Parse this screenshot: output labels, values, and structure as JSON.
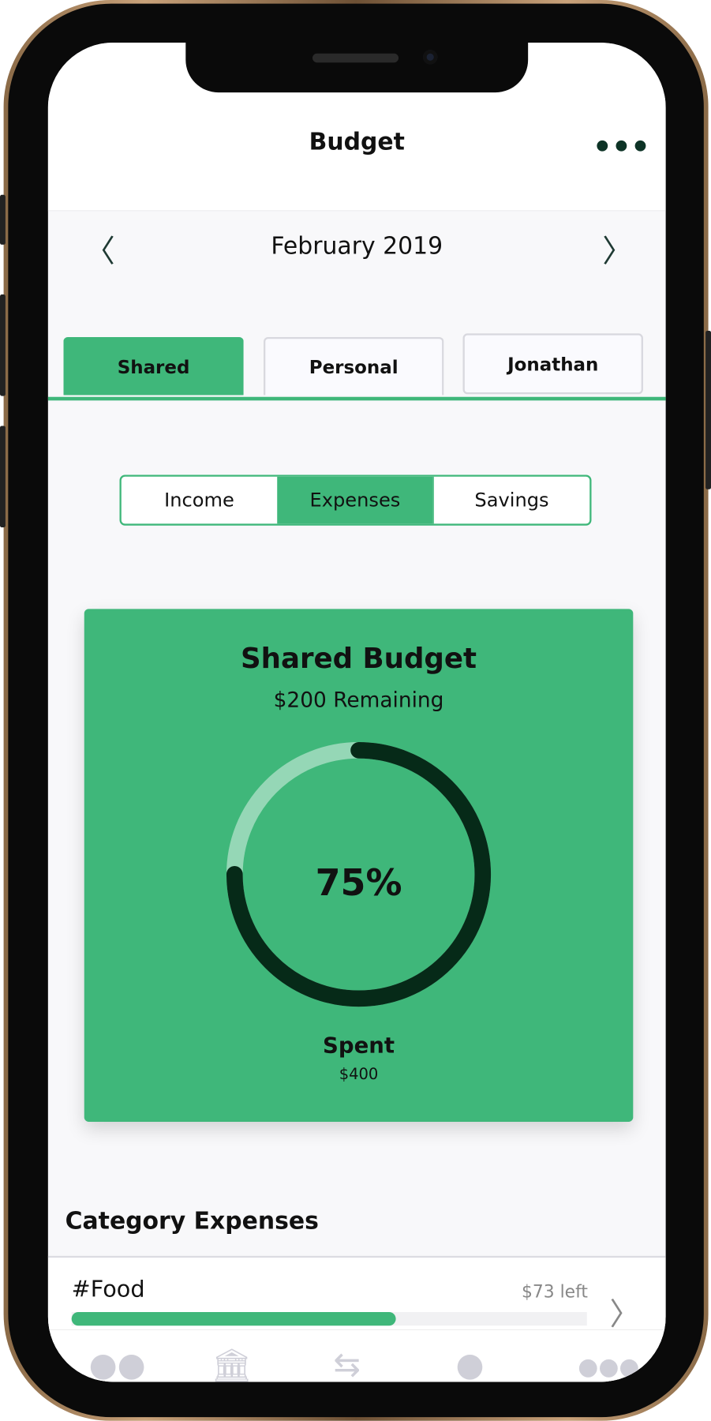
{
  "header": {
    "title": "Budget",
    "menu_icon": "more-dots-icon"
  },
  "month_nav": {
    "label": "February 2019",
    "prev_icon": "chevron-left-icon",
    "next_icon": "chevron-right-icon"
  },
  "tabs": [
    {
      "label": "Shared",
      "active": true
    },
    {
      "label": "Personal",
      "active": false
    },
    {
      "label": "Jonathan",
      "active": false
    }
  ],
  "segments": [
    {
      "label": "Income",
      "active": false
    },
    {
      "label": "Expenses",
      "active": true
    },
    {
      "label": "Savings",
      "active": false
    }
  ],
  "budget_card": {
    "title": "Shared Budget",
    "remaining": "$200 Remaining",
    "percent_label": "75%",
    "percent_value": 75,
    "spent_label": "Spent",
    "spent_value": "$400"
  },
  "category_section": {
    "title": "Category Expenses",
    "items": [
      {
        "name": "#Food",
        "left": "$73 left",
        "progress_percent": 63
      }
    ]
  },
  "bottom_nav": [
    "binoculars-icon",
    "bank-icon",
    "transfer-icon",
    "chat-icon",
    "more-icon"
  ],
  "colors": {
    "accent": "#3fb77a",
    "ring_dark": "#062a18",
    "dots": "#0d3326"
  }
}
